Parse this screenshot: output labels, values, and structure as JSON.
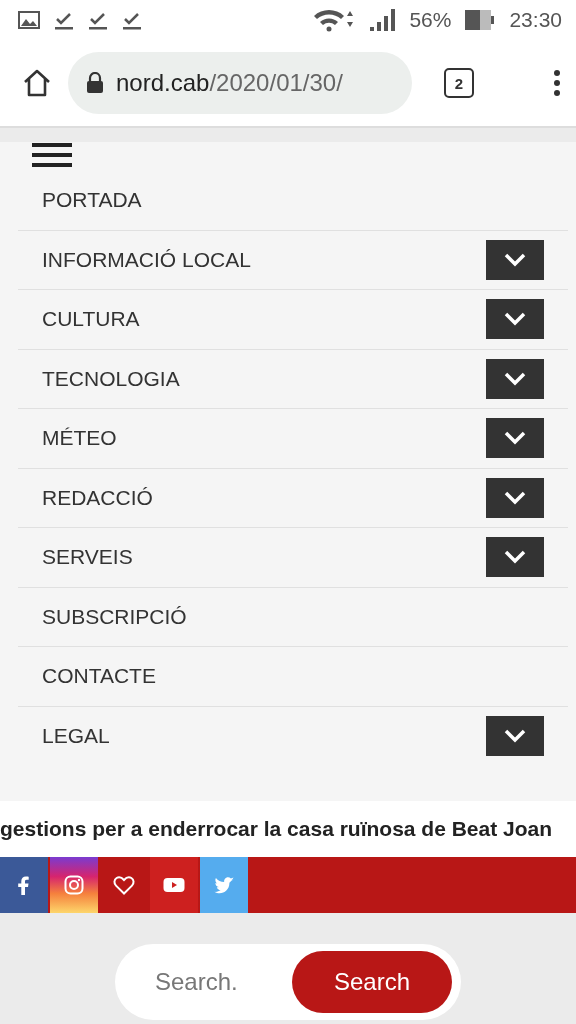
{
  "status_bar": {
    "battery": "56%",
    "time": "23:30"
  },
  "browser": {
    "url_host": "nord.cab",
    "url_path": "/2020/01/30/",
    "tab_count": "2"
  },
  "menu": {
    "items": [
      {
        "label": "PORTADA",
        "expandable": false
      },
      {
        "label": "INFORMACIÓ LOCAL",
        "expandable": true
      },
      {
        "label": "CULTURA",
        "expandable": true
      },
      {
        "label": "TECNOLOGIA",
        "expandable": true
      },
      {
        "label": "MÉTEO",
        "expandable": true
      },
      {
        "label": "REDACCIÓ",
        "expandable": true
      },
      {
        "label": "SERVEIS",
        "expandable": true
      },
      {
        "label": "SUBSCRIPCIÓ",
        "expandable": false
      },
      {
        "label": "CONTACTE",
        "expandable": false
      },
      {
        "label": "LEGAL",
        "expandable": true
      }
    ]
  },
  "ticker": {
    "text": "gestions per a enderrocar la casa ruïnosa de Beat Joan"
  },
  "social": [
    {
      "kind": "facebook"
    },
    {
      "kind": "instagram"
    },
    {
      "kind": "heart"
    },
    {
      "kind": "youtube"
    },
    {
      "kind": "twitter"
    }
  ],
  "search": {
    "placeholder": "Search.",
    "button": "Search"
  }
}
